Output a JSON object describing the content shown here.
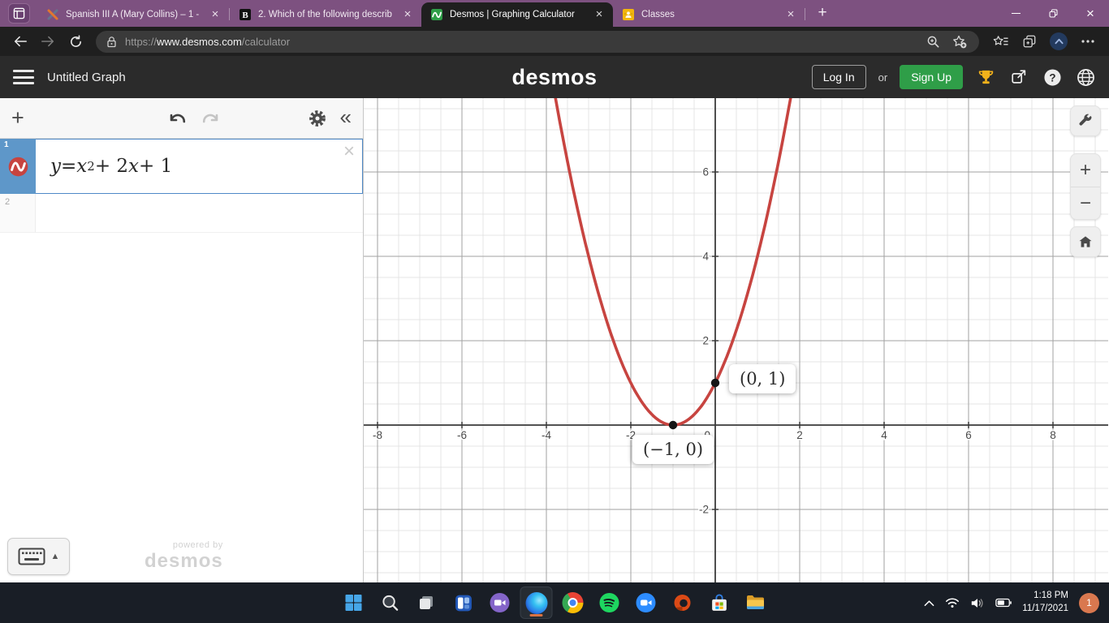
{
  "browser": {
    "tabs": [
      {
        "title": "Spanish III A (Mary Collins) – 1 -",
        "icon": "x-logo-favicon",
        "active": false
      },
      {
        "title": "2. Which of the following describ",
        "icon": "b-logo-favicon",
        "active": false
      },
      {
        "title": "Desmos | Graphing Calculator",
        "icon": "desmos-favicon",
        "active": true
      },
      {
        "title": "Classes",
        "icon": "classroom-favicon",
        "active": false
      }
    ],
    "url": {
      "scheme": "https://",
      "host": "www.desmos.com",
      "path": "/calculator"
    },
    "icons": {
      "close_tab": "×",
      "new_tab": "+",
      "more": "ellipsis-icon",
      "window_close": "×"
    }
  },
  "desmos_header": {
    "graph_title": "Untitled Graph",
    "logo_text": "desmos",
    "login_label": "Log In",
    "or_label": "or",
    "signup_label": "Sign Up",
    "signup_color": "#2f9e48",
    "right_icons": [
      "trophy-icon",
      "share-icon",
      "help-icon",
      "globe-icon"
    ]
  },
  "expressions": {
    "toolbar_icons": [
      "add-expression-icon",
      "undo-icon",
      "redo-icon",
      "settings-gear-icon",
      "collapse-panel-icon"
    ],
    "add_label": "+",
    "collapse_label": "«",
    "row1": {
      "number": "1",
      "close_label": "×",
      "equation_parts": [
        {
          "text": "y",
          "italic": true
        },
        {
          "text": " = ",
          "italic": false
        },
        {
          "text": "x",
          "italic": true
        },
        {
          "text": "2",
          "sup": true
        },
        {
          "text": " + 2",
          "italic": false
        },
        {
          "text": "x",
          "italic": true
        },
        {
          "text": " + 1",
          "italic": false
        }
      ],
      "curve_color": "#c74440"
    },
    "row2_number": "2",
    "keyboard_arrow": "▲",
    "watermark_line1": "powered by",
    "watermark_line2": "desmos"
  },
  "graph_controls": {
    "zoom_in": "+",
    "zoom_out": "−",
    "icons": [
      "wrench-icon",
      "zoom-in-button",
      "zoom-out-button",
      "home-icon"
    ]
  },
  "chart_data": {
    "type": "line",
    "title": "Untitled Graph",
    "equation": "y = x^2 + 2x + 1",
    "series": [
      {
        "name": "y = x^2 + 2x + 1",
        "color": "#c74440",
        "function": "(x+1)^2"
      }
    ],
    "x_visible_range": [
      -8.33,
      9.33
    ],
    "y_visible_range": [
      -3.73,
      7.75
    ],
    "x_tick_labels": [
      -8,
      -6,
      -4,
      -2,
      0,
      2,
      4,
      6,
      8
    ],
    "y_tick_labels": [
      -2,
      2,
      4,
      6
    ],
    "grid": {
      "minor_step": 0.5,
      "major_step": 2,
      "minor_color": "#e4e4e4",
      "major_color": "#a2a2a2",
      "axis_color": "#3a3a3a",
      "label_color": "#4a4a4a"
    },
    "points": [
      {
        "x": -1,
        "y": 0,
        "label": "(−1, 0)",
        "label_placement": "below"
      },
      {
        "x": 0,
        "y": 1,
        "label": "(0, 1)",
        "label_placement": "right"
      }
    ]
  },
  "taskbar": {
    "apps": [
      "start",
      "search",
      "task-view",
      "widgets",
      "video-chat",
      "edge",
      "chrome",
      "spotify",
      "zoom",
      "office",
      "microsoft-store",
      "file-explorer"
    ],
    "active_app": "edge",
    "tray_icons": [
      "chevron-up-icon",
      "wifi-icon",
      "volume-icon",
      "battery-icon"
    ],
    "clock_time": "1:18 PM",
    "clock_date": "11/17/2021",
    "badge_count": "1"
  }
}
